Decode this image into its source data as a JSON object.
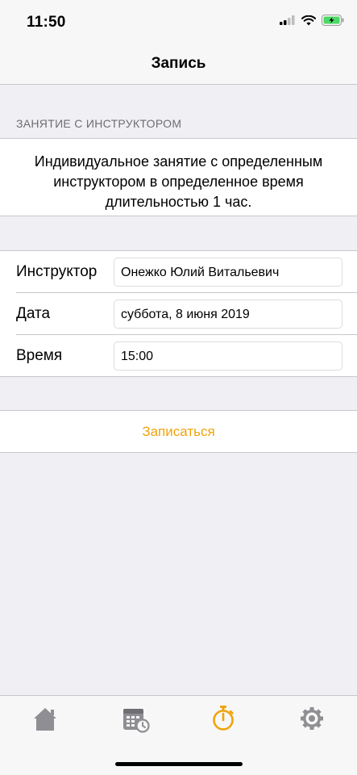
{
  "status_bar": {
    "time": "11:50"
  },
  "nav": {
    "title": "Запись"
  },
  "section": {
    "header": "ЗАНЯТИЕ С ИНСТРУКТОРОМ",
    "description": "Индивидуальное занятие с определенным инструктором в определенное время длительностью 1 час."
  },
  "form": {
    "instructor_label": "Инструктор",
    "instructor_value": "Онежко Юлий Витальевич",
    "date_label": "Дата",
    "date_value": "суббота, 8 июня 2019",
    "time_label": "Время",
    "time_value": "15:00"
  },
  "submit_label": "Записаться",
  "colors": {
    "accent": "#f0a30a",
    "inactive_tab": "#8e8e93"
  },
  "tabbar": {
    "items": [
      {
        "icon": "home-icon",
        "active": false
      },
      {
        "icon": "calendar-clock-icon",
        "active": false
      },
      {
        "icon": "stopwatch-icon",
        "active": true
      },
      {
        "icon": "gear-icon",
        "active": false
      }
    ]
  }
}
